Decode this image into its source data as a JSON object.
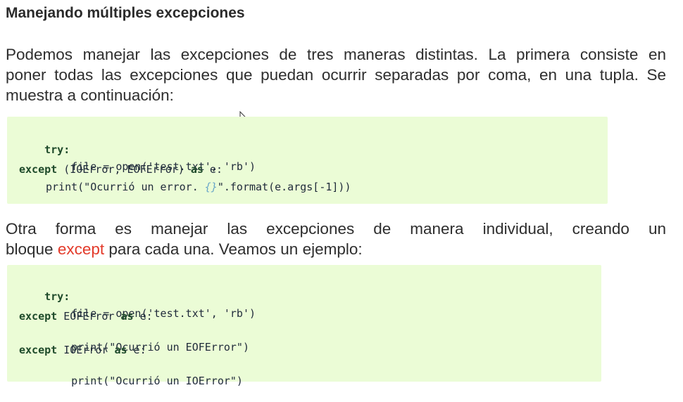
{
  "title": "Manejando múltiples excepciones",
  "paragraph1": {
    "lines": [
      "Podemos manejar las excepciones de tres maneras distintas. La primera consiste en",
      "poner todas las excepciones que puedan ocurrir separadas por coma, en una tupla. Se",
      "muestra a continuación:"
    ]
  },
  "code1": {
    "try_kw": "try:",
    "line2": "file = open('test.txt', 'rb')",
    "except_kw": "except",
    "line3_rest": " (IOError, EOFError) ",
    "as_kw": "as",
    "line3_end": " e:",
    "print_start": "print(\"Ocurrió un error. ",
    "print_fmt": "{}",
    "print_end": "\".format(e.args[-1]))"
  },
  "paragraph2": {
    "line1": "Otra forma es manejar las excepciones de manera individual, creando un",
    "line2_start": "bloque ",
    "line2_highlight": "except",
    "line2_end": " para cada una. Veamos un ejemplo:"
  },
  "code2": {
    "try_kw": "try:",
    "line2": "file = open('test.txt', 'rb')",
    "except_kw": "except",
    "err1": " EOFError ",
    "as_kw": "as",
    "e_colon": " e:",
    "print1": "print(\"Ocurrió un EOFError\")",
    "err2": " IOError ",
    "print2": "print(\"Ocurrió un IOError\")"
  },
  "colors": {
    "code_background": "#ebfcd6",
    "highlight": "#e33a2a"
  },
  "icons": {
    "cursor": "mouse-pointer-icon"
  }
}
